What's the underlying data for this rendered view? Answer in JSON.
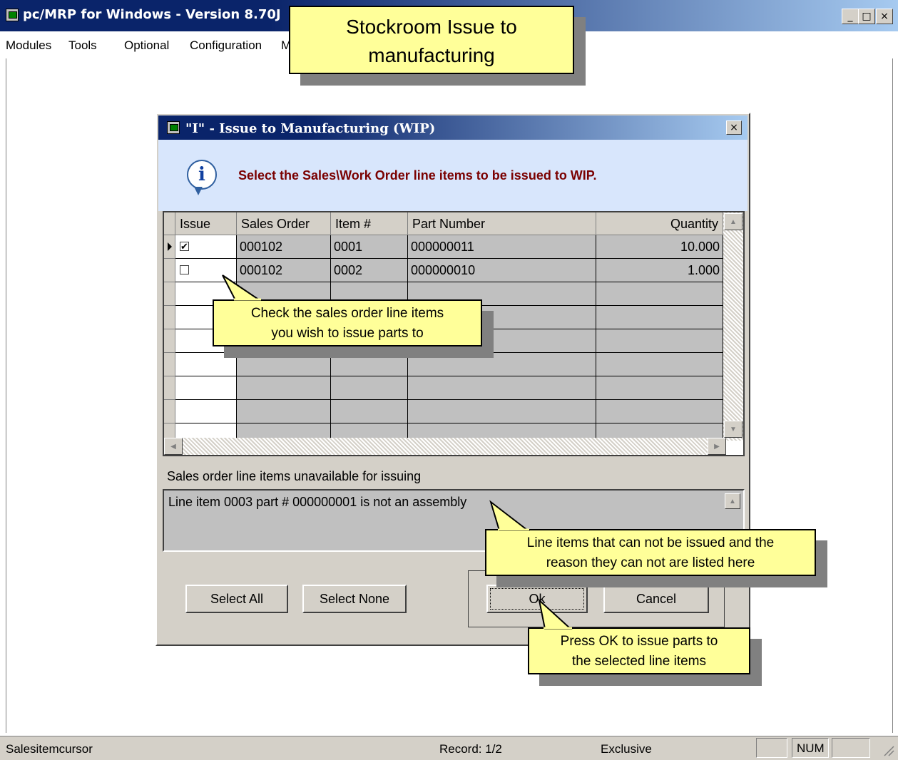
{
  "window": {
    "title": "pc/MRP for Windows - Version 8.70J",
    "controls": {
      "minimize": "_",
      "maximize": "□",
      "close": "×"
    }
  },
  "menu": [
    "Modules",
    "Tools",
    "Optional",
    "Configuration",
    "M"
  ],
  "callouts": {
    "header": "Stockroom Issue to manufacturing",
    "check_line1": "Check the sales order line items",
    "check_line2": "you wish to issue parts to",
    "unavail_line1": "Line items that can not be issued and the",
    "unavail_line2": "reason they can not are listed here",
    "ok_line1": "Press OK to issue parts to",
    "ok_line2": "the selected line items"
  },
  "dialog": {
    "title": "\"I\" - Issue to Manufacturing (WIP)",
    "close": "×",
    "info_message": "Select the Sales\\Work Order line items to be issued to WIP.",
    "grid": {
      "columns": [
        "Issue",
        "Sales Order",
        "Item #",
        "Part Number",
        "Quantity"
      ],
      "rows": [
        {
          "issue": true,
          "sales_order": "000102",
          "item": "0001",
          "part_number": "000000011",
          "quantity": "10.000"
        },
        {
          "issue": false,
          "sales_order": "000102",
          "item": "0002",
          "part_number": "000000010",
          "quantity": "1.000"
        }
      ]
    },
    "unavailable_label": "Sales order line items unavailable for issuing",
    "unavailable_text": "Line item 0003 part # 000000001 is not an assembly",
    "buttons": {
      "select_all": "Select All",
      "select_none": "Select None",
      "ok": "Ok",
      "cancel": "Cancel"
    }
  },
  "status": {
    "cursor": "Salesitemcursor",
    "record": "Record: 1/2",
    "mode": "Exclusive",
    "num": "NUM"
  }
}
